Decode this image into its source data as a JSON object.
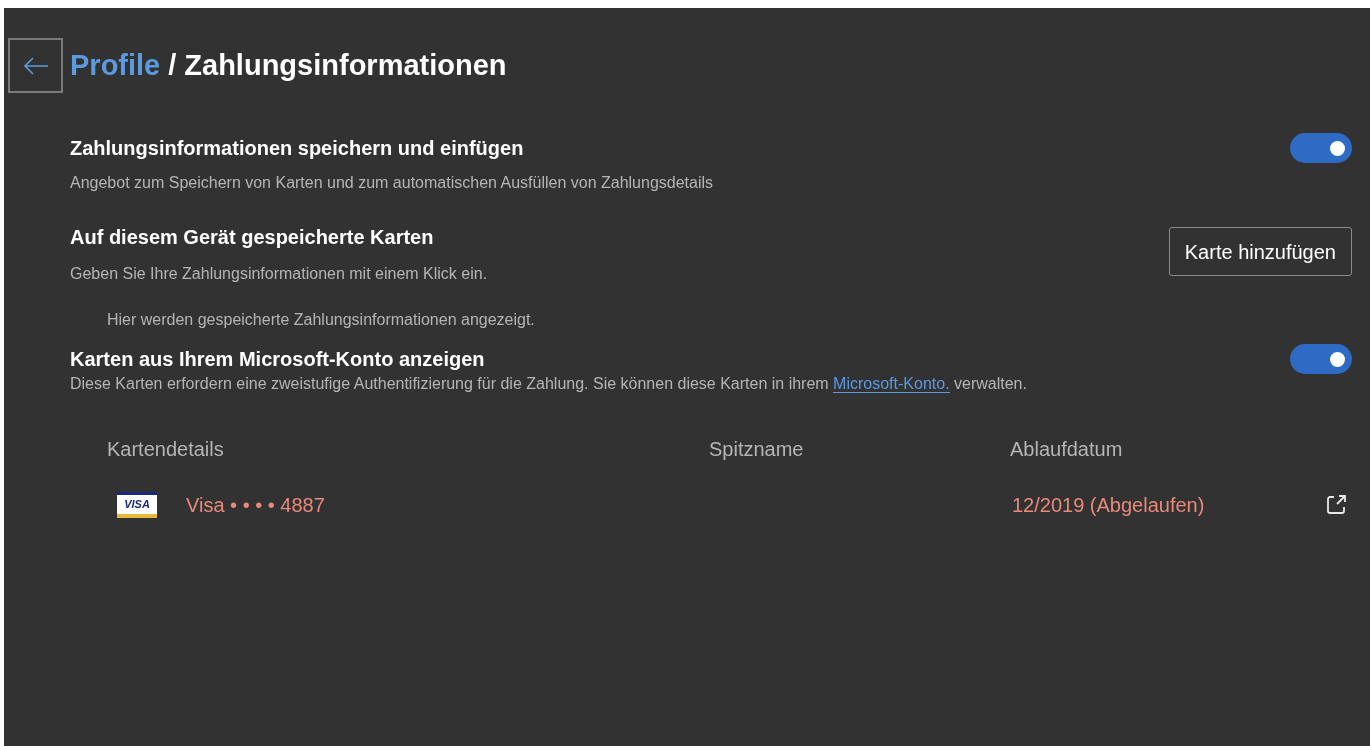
{
  "breadcrumb": {
    "parent": "Profile",
    "separator": "/",
    "current": "Zahlungsinformationen"
  },
  "save_setting": {
    "title": "Zahlungsinformationen speichern und einfügen",
    "description": "Angebot zum Speichern von Karten und zum automatischen Ausfüllen von Zahlungsdetails",
    "on": true
  },
  "local_cards": {
    "title": "Auf diesem Gerät gespeicherte Karten",
    "description": "Geben Sie Ihre Zahlungsinformationen mit einem Klick ein.",
    "button": "Karte hinzufügen",
    "empty_text": "Hier werden gespeicherte Zahlungsinformationen angezeigt."
  },
  "account_cards": {
    "title": "Karten aus Ihrem Microsoft-Konto anzeigen",
    "description_before": "Diese Karten erfordern eine zweistufige Authentifizierung für die Zahlung. Sie können diese Karten in ihrem ",
    "link": "Microsoft-Konto.",
    "description_after": " verwalten.",
    "on": true
  },
  "table": {
    "columns": [
      "Kartendetails",
      "Spitzname",
      "Ablaufdatum"
    ],
    "rows": [
      {
        "brand_logo": "VISA",
        "card": "Visa • • • • 4887",
        "nickname": "",
        "expiry": "12/2019 (Abgelaufen)",
        "expired": true
      }
    ]
  }
}
